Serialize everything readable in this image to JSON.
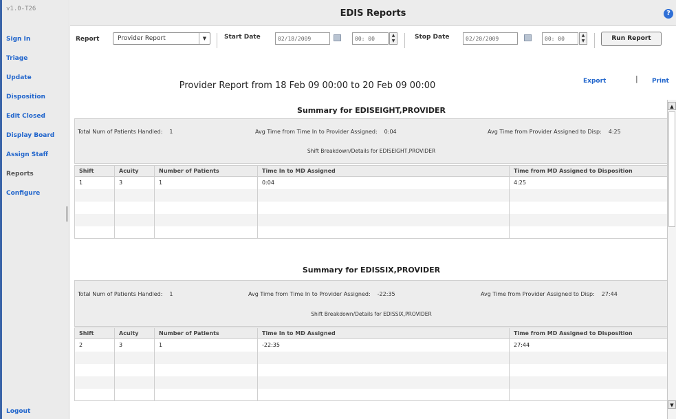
{
  "app": {
    "version": "v1.0-T26",
    "title": "EDIS Reports",
    "help_icon": "help-icon"
  },
  "sidebar": {
    "items": [
      {
        "label": "Sign In"
      },
      {
        "label": "Triage"
      },
      {
        "label": "Update"
      },
      {
        "label": "Disposition"
      },
      {
        "label": "Edit Closed"
      },
      {
        "label": "Display Board"
      },
      {
        "label": "Assign Staff"
      },
      {
        "label": "Reports"
      },
      {
        "label": "Configure"
      }
    ],
    "active": "Reports",
    "logout": "Logout"
  },
  "toolbar": {
    "report_label": "Report",
    "report_value": "Provider Report",
    "start_label": "Start Date",
    "start_date": "02/18/2009",
    "start_time": "00: 00",
    "stop_label": "Stop Date",
    "stop_date": "02/20/2009",
    "stop_time": "00: 00",
    "run_button": "Run Report"
  },
  "report": {
    "title": "Provider Report from 18 Feb 09 00:00 to 20 Feb 09 00:00",
    "export": "Export",
    "separator": "|",
    "print": "Print"
  },
  "columns": [
    "Shift",
    "Acuity",
    "Number of Patients",
    "Time In to MD Assigned",
    "Time from MD Assigned to Disposition"
  ],
  "summaries": [
    {
      "title": "Summary for EDISEIGHT,PROVIDER",
      "patients_label": "Total Num of Patients Handled:",
      "patients_value": "1",
      "avg_in_label": "Avg Time from Time In to Provider Assigned:",
      "avg_in_value": "0:04",
      "avg_disp_label": "Avg Time from Provider Assigned to Disp:",
      "avg_disp_value": "4:25",
      "shift_caption": "Shift Breakdown/Details for EDISEIGHT,PROVIDER",
      "rows": [
        {
          "shift": "1",
          "acuity": "3",
          "patients": "1",
          "time_in": "0:04",
          "time_disp": "4:25"
        }
      ]
    },
    {
      "title": "Summary for EDISSIX,PROVIDER",
      "patients_label": "Total Num of Patients Handled:",
      "patients_value": "1",
      "avg_in_label": "Avg Time from Time In to Provider Assigned:",
      "avg_in_value": "-22:35",
      "avg_disp_label": "Avg Time from Provider Assigned to Disp:",
      "avg_disp_value": "27:44",
      "shift_caption": "Shift Breakdown/Details for EDISSIX,PROVIDER",
      "rows": [
        {
          "shift": "2",
          "acuity": "3",
          "patients": "1",
          "time_in": "-22:35",
          "time_disp": "27:44"
        }
      ]
    }
  ]
}
